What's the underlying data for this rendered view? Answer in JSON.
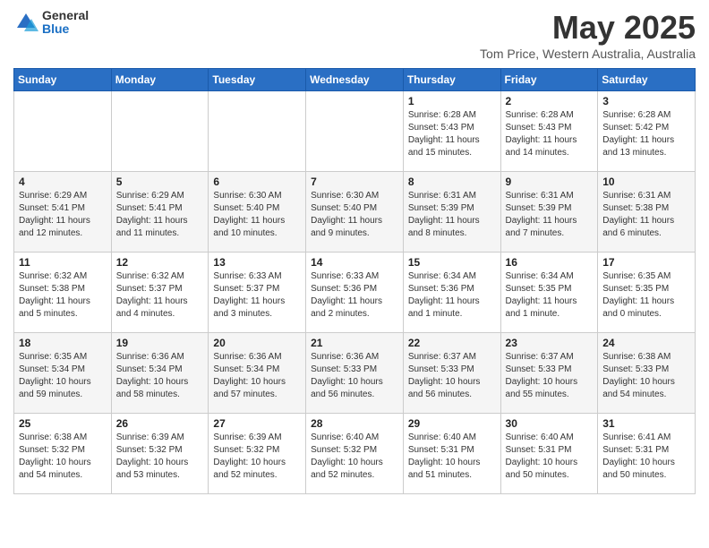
{
  "header": {
    "logo_general": "General",
    "logo_blue": "Blue",
    "title": "May 2025",
    "location": "Tom Price, Western Australia, Australia"
  },
  "days_of_week": [
    "Sunday",
    "Monday",
    "Tuesday",
    "Wednesday",
    "Thursday",
    "Friday",
    "Saturday"
  ],
  "weeks": [
    [
      {
        "day": "",
        "info": ""
      },
      {
        "day": "",
        "info": ""
      },
      {
        "day": "",
        "info": ""
      },
      {
        "day": "",
        "info": ""
      },
      {
        "day": "1",
        "info": "Sunrise: 6:28 AM\nSunset: 5:43 PM\nDaylight: 11 hours\nand 15 minutes."
      },
      {
        "day": "2",
        "info": "Sunrise: 6:28 AM\nSunset: 5:43 PM\nDaylight: 11 hours\nand 14 minutes."
      },
      {
        "day": "3",
        "info": "Sunrise: 6:28 AM\nSunset: 5:42 PM\nDaylight: 11 hours\nand 13 minutes."
      }
    ],
    [
      {
        "day": "4",
        "info": "Sunrise: 6:29 AM\nSunset: 5:41 PM\nDaylight: 11 hours\nand 12 minutes."
      },
      {
        "day": "5",
        "info": "Sunrise: 6:29 AM\nSunset: 5:41 PM\nDaylight: 11 hours\nand 11 minutes."
      },
      {
        "day": "6",
        "info": "Sunrise: 6:30 AM\nSunset: 5:40 PM\nDaylight: 11 hours\nand 10 minutes."
      },
      {
        "day": "7",
        "info": "Sunrise: 6:30 AM\nSunset: 5:40 PM\nDaylight: 11 hours\nand 9 minutes."
      },
      {
        "day": "8",
        "info": "Sunrise: 6:31 AM\nSunset: 5:39 PM\nDaylight: 11 hours\nand 8 minutes."
      },
      {
        "day": "9",
        "info": "Sunrise: 6:31 AM\nSunset: 5:39 PM\nDaylight: 11 hours\nand 7 minutes."
      },
      {
        "day": "10",
        "info": "Sunrise: 6:31 AM\nSunset: 5:38 PM\nDaylight: 11 hours\nand 6 minutes."
      }
    ],
    [
      {
        "day": "11",
        "info": "Sunrise: 6:32 AM\nSunset: 5:38 PM\nDaylight: 11 hours\nand 5 minutes."
      },
      {
        "day": "12",
        "info": "Sunrise: 6:32 AM\nSunset: 5:37 PM\nDaylight: 11 hours\nand 4 minutes."
      },
      {
        "day": "13",
        "info": "Sunrise: 6:33 AM\nSunset: 5:37 PM\nDaylight: 11 hours\nand 3 minutes."
      },
      {
        "day": "14",
        "info": "Sunrise: 6:33 AM\nSunset: 5:36 PM\nDaylight: 11 hours\nand 2 minutes."
      },
      {
        "day": "15",
        "info": "Sunrise: 6:34 AM\nSunset: 5:36 PM\nDaylight: 11 hours\nand 1 minute."
      },
      {
        "day": "16",
        "info": "Sunrise: 6:34 AM\nSunset: 5:35 PM\nDaylight: 11 hours\nand 1 minute."
      },
      {
        "day": "17",
        "info": "Sunrise: 6:35 AM\nSunset: 5:35 PM\nDaylight: 11 hours\nand 0 minutes."
      }
    ],
    [
      {
        "day": "18",
        "info": "Sunrise: 6:35 AM\nSunset: 5:34 PM\nDaylight: 10 hours\nand 59 minutes."
      },
      {
        "day": "19",
        "info": "Sunrise: 6:36 AM\nSunset: 5:34 PM\nDaylight: 10 hours\nand 58 minutes."
      },
      {
        "day": "20",
        "info": "Sunrise: 6:36 AM\nSunset: 5:34 PM\nDaylight: 10 hours\nand 57 minutes."
      },
      {
        "day": "21",
        "info": "Sunrise: 6:36 AM\nSunset: 5:33 PM\nDaylight: 10 hours\nand 56 minutes."
      },
      {
        "day": "22",
        "info": "Sunrise: 6:37 AM\nSunset: 5:33 PM\nDaylight: 10 hours\nand 56 minutes."
      },
      {
        "day": "23",
        "info": "Sunrise: 6:37 AM\nSunset: 5:33 PM\nDaylight: 10 hours\nand 55 minutes."
      },
      {
        "day": "24",
        "info": "Sunrise: 6:38 AM\nSunset: 5:33 PM\nDaylight: 10 hours\nand 54 minutes."
      }
    ],
    [
      {
        "day": "25",
        "info": "Sunrise: 6:38 AM\nSunset: 5:32 PM\nDaylight: 10 hours\nand 54 minutes."
      },
      {
        "day": "26",
        "info": "Sunrise: 6:39 AM\nSunset: 5:32 PM\nDaylight: 10 hours\nand 53 minutes."
      },
      {
        "day": "27",
        "info": "Sunrise: 6:39 AM\nSunset: 5:32 PM\nDaylight: 10 hours\nand 52 minutes."
      },
      {
        "day": "28",
        "info": "Sunrise: 6:40 AM\nSunset: 5:32 PM\nDaylight: 10 hours\nand 52 minutes."
      },
      {
        "day": "29",
        "info": "Sunrise: 6:40 AM\nSunset: 5:31 PM\nDaylight: 10 hours\nand 51 minutes."
      },
      {
        "day": "30",
        "info": "Sunrise: 6:40 AM\nSunset: 5:31 PM\nDaylight: 10 hours\nand 50 minutes."
      },
      {
        "day": "31",
        "info": "Sunrise: 6:41 AM\nSunset: 5:31 PM\nDaylight: 10 hours\nand 50 minutes."
      }
    ]
  ]
}
